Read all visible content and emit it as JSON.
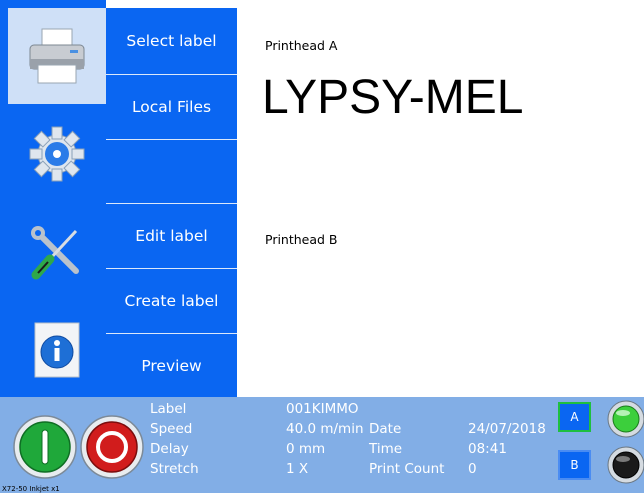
{
  "nav": {
    "icons": [
      {
        "name": "printer-icon",
        "active": true
      },
      {
        "name": "settings-gear-icon",
        "active": false
      },
      {
        "name": "tools-icon",
        "active": false
      },
      {
        "name": "info-icon",
        "active": false
      }
    ]
  },
  "menu": {
    "items": [
      "Select label",
      "Local Files",
      "",
      "Edit label",
      "Create label",
      "Preview"
    ]
  },
  "main": {
    "printhead_a": {
      "label": "Printhead A",
      "text": "LYPSY-MEL"
    },
    "printhead_b": {
      "label": "Printhead B",
      "text": ""
    }
  },
  "status": {
    "label_key": "Label",
    "label_value": "001KIMMO",
    "speed_key": "Speed",
    "speed_value": "40.0 m/min",
    "delay_key": "Delay",
    "delay_value": "0 mm",
    "stretch_key": "Stretch",
    "stretch_value": "1 X",
    "date_key": "Date",
    "date_value": "24/07/2018",
    "time_key": "Time",
    "time_value": "08:41",
    "print_count_key": "Print Count",
    "print_count_value": "0",
    "button_a": "A",
    "button_b": "B",
    "version": "X72-50 Inkjet x1"
  },
  "colors": {
    "menu_blue": "#0a66f2",
    "status_bar": "#82aee6",
    "start_button": "#1fa83a",
    "stop_button": "#d11c1c",
    "indicator_a": "#3ccf3c",
    "indicator_b": "#1a1a1a"
  }
}
